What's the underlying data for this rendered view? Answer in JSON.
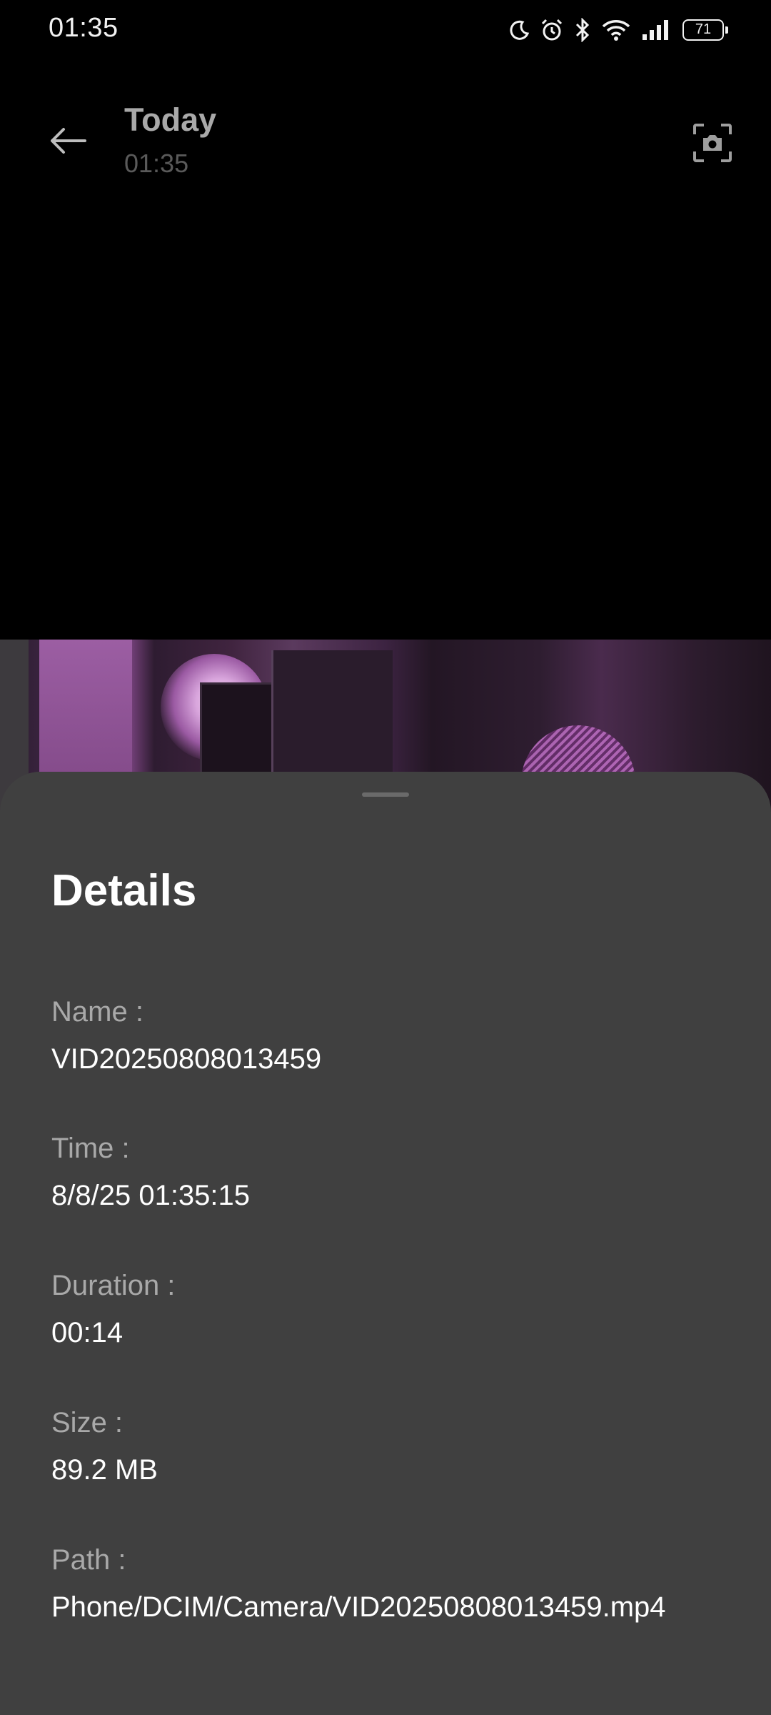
{
  "status_bar": {
    "time": "01:35",
    "battery": "71",
    "icons": [
      "moon-icon",
      "alarm-icon",
      "bluetooth-icon",
      "wifi-icon",
      "signal-icon",
      "battery-icon"
    ]
  },
  "header": {
    "title": "Today",
    "subtitle": "01:35"
  },
  "details": {
    "title": "Details",
    "items": [
      {
        "label": "Name :",
        "value": "VID20250808013459"
      },
      {
        "label": "Time :",
        "value": "8/8/25 01:35:15"
      },
      {
        "label": "Duration :",
        "value": "00:14"
      },
      {
        "label": "Size :",
        "value": "89.2 MB"
      },
      {
        "label": "Path :",
        "value": "Phone/DCIM/Camera/VID20250808013459.mp4"
      }
    ]
  },
  "colors": {
    "background": "#000000",
    "sheet": "#404040",
    "label": "#a9a9a9",
    "value": "#ffffff"
  }
}
